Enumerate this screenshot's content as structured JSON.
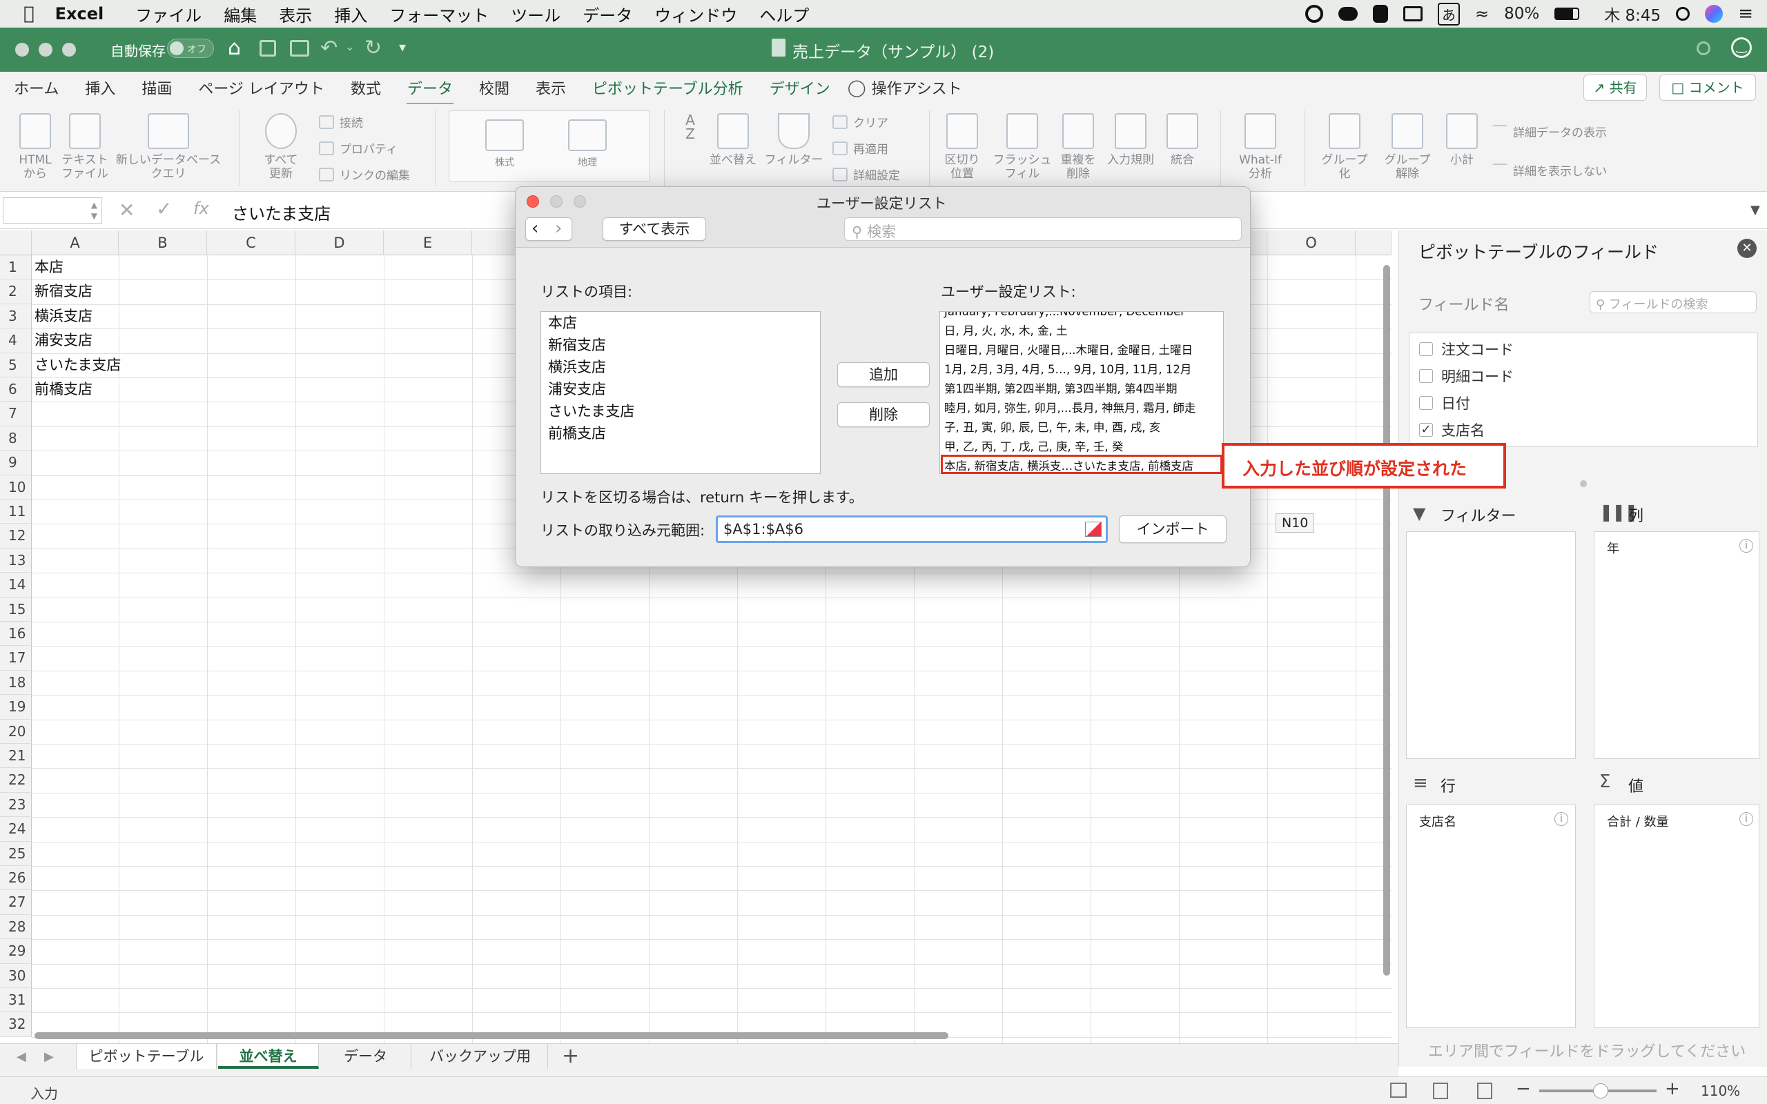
{
  "menubar": {
    "app": "Excel",
    "items": [
      "ファイル",
      "編集",
      "表示",
      "挿入",
      "フォーマット",
      "ツール",
      "データ",
      "ウィンドウ",
      "ヘルプ"
    ],
    "battery": "80%",
    "clock": "木 8:45",
    "ime": "あ"
  },
  "titlebar": {
    "autosave_label": "自動保存",
    "autosave_state": "オフ",
    "doc_title": "売上データ（サンプル） (2)"
  },
  "ribbon_tabs": [
    "ホーム",
    "挿入",
    "描画",
    "ページ レイアウト",
    "数式",
    "データ",
    "校閲",
    "表示",
    "ピボットテーブル分析",
    "デザイン"
  ],
  "ribbon_tab_assist": "操作アシスト",
  "share_label": "共有",
  "comment_label": "コメント",
  "ribbon": {
    "html_from": "HTML\nから",
    "text_file": "テキスト\nファイル",
    "new_query": "新しいデータベース\nクエリ",
    "connect": "接続",
    "properties": "プロパティ",
    "edit_links": "リンクの編集",
    "refresh_all": "すべて\n更新",
    "stocks": "株式",
    "geo": "地理",
    "sort": "並べ替え",
    "filter": "フィルター",
    "clear": "クリア",
    "reapply": "再適用",
    "advanced": "詳細設定",
    "text_to_cols": "区切り\n位置",
    "flash_fill": "フラッシュ\nフィル",
    "remove_dup": "重複を\n削除",
    "validation": "入力規則",
    "consolidate": "統合",
    "whatif": "What-If\n分析",
    "group": "グループ\n化",
    "ungroup": "グループ\n解除",
    "subtotal": "小計",
    "show_detail": "詳細データの表示",
    "hide_detail": "詳細を表示しない"
  },
  "formula": {
    "namebox": "",
    "content": "さいたま支店",
    "fx": "fx"
  },
  "grid": {
    "columns": [
      "A",
      "B",
      "C",
      "D",
      "E",
      "O"
    ],
    "rows": [
      "1",
      "2",
      "3",
      "4",
      "5",
      "6",
      "7",
      "8",
      "9",
      "10",
      "11",
      "12",
      "13",
      "14",
      "15",
      "16",
      "17",
      "18",
      "19",
      "20",
      "21",
      "22",
      "23",
      "24",
      "25",
      "26",
      "27",
      "28",
      "29",
      "30",
      "31",
      "32"
    ],
    "cells": [
      "本店",
      "新宿支店",
      "横浜支店",
      "浦安支店",
      "さいたま支店",
      "前橋支店"
    ],
    "tooltip": "N10"
  },
  "sheet_tabs": [
    "ピボットテーブル",
    "並べ替え",
    "データ",
    "バックアップ用"
  ],
  "status": {
    "mode": "入力",
    "zoom": "110%"
  },
  "pivot": {
    "title": "ピボットテーブルのフィールド",
    "field_name": "フィールド名",
    "search_placeholder": "フィールドの検索",
    "fields": [
      {
        "label": "注文コード",
        "checked": false
      },
      {
        "label": "明細コード",
        "checked": false
      },
      {
        "label": "日付",
        "checked": false
      },
      {
        "label": "支店名",
        "checked": true
      }
    ],
    "filter_label": "フィルター",
    "col_label": "列",
    "row_label": "行",
    "val_label": "値",
    "col_item": "年",
    "row_item": "支店名",
    "val_item": "合計 / 数量",
    "footer": "エリア間でフィールドをドラッグしてください"
  },
  "dialog": {
    "title": "ユーザー設定リスト",
    "show_all": "すべて表示",
    "search_placeholder": "検索",
    "list_items_label": "リストの項目:",
    "custom_lists_label": "ユーザー設定リスト:",
    "list_items": [
      "本店",
      "新宿支店",
      "横浜支店",
      "浦安支店",
      "さいたま支店",
      "前橋支店"
    ],
    "custom_lists": [
      "January, February,...November, December",
      "日, 月, 火, 水, 木, 金, 土",
      "日曜日, 月曜日, 火曜日,...木曜日, 金曜日, 土曜日",
      "1月, 2月, 3月, 4月, 5…, 9月, 10月, 11月, 12月",
      "第1四半期, 第2四半期, 第3四半期, 第4四半期",
      "睦月, 如月, 弥生, 卯月,...長月, 神無月, 霜月, 師走",
      "子, 丑, 寅, 卯, 辰, 巳, 午, 未, 申, 酉, 戌, 亥",
      "甲, 乙, 丙, 丁, 戊, 己, 庚, 辛, 壬, 癸",
      "本店, 新宿支店, 横浜支…さいたま支店, 前橋支店"
    ],
    "add": "追加",
    "delete": "削除",
    "hint": "リストを区切る場合は、return キーを押します。",
    "range_label": "リストの取り込み元範囲:",
    "range_value": "$A$1:$A$6",
    "import": "インポート"
  },
  "annotation": {
    "text": "入力した並び順が設定された",
    "color": "#e0301e"
  }
}
